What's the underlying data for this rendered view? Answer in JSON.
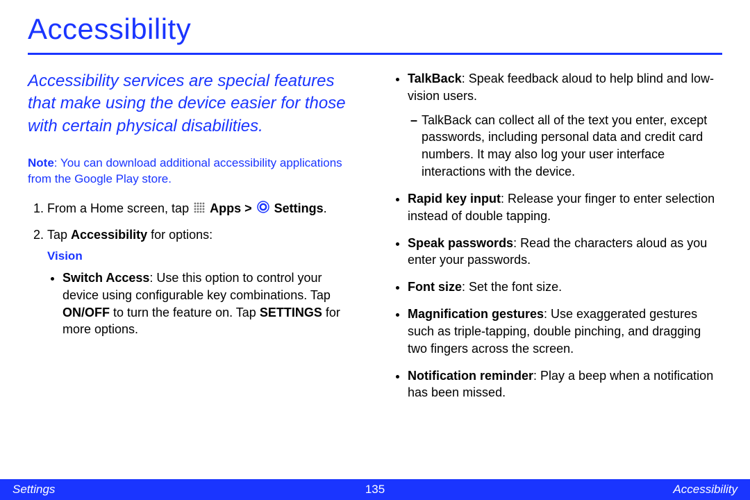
{
  "title": "Accessibility",
  "intro": "Accessibility services are special features that make using the device easier for those with certain physical disabilities.",
  "note_label": "Note",
  "note_text": ": You can download additional accessibility applications from the Google Play store.",
  "step1_pre": "From a Home screen, tap ",
  "step1_apps": "Apps > ",
  "step1_settings": "Settings",
  "step1_post": ".",
  "step2_pre": "Tap ",
  "step2_bold": "Accessibility",
  "step2_post": " for options:",
  "vision_label": "Vision",
  "switch_bold": "Switch Access",
  "switch_a": ": Use this option to control your device using configurable key combinations. Tap ",
  "switch_onoff": "ON/OFF",
  "switch_b": " to turn the feature on. Tap ",
  "switch_settings": "SETTINGS",
  "switch_c": " for more options.",
  "talkback_bold": "TalkBack",
  "talkback_text": ": Speak feedback aloud to help blind and low-vision users.",
  "talkback_sub": "TalkBack can collect all of the text you enter, except passwords, including personal data and credit card numbers. It may also log your user interface interactions with the device.",
  "rapid_bold": "Rapid key input",
  "rapid_text": ": Release your finger to enter selection instead of double tapping.",
  "speakpw_bold": "Speak passwords",
  "speakpw_text": ": Read the characters aloud as you enter your passwords.",
  "fontsize_bold": "Font size",
  "fontsize_text": ": Set the font size.",
  "mag_bold": "Magnification gestures",
  "mag_text": ": Use exaggerated gestures such as triple-tapping, double pinching, and dragging two fingers across the screen.",
  "notif_bold": "Notification reminder",
  "notif_text": ": Play a beep when a notification has been missed.",
  "footer_left": "Settings",
  "footer_page": "135",
  "footer_right": "Accessibility"
}
